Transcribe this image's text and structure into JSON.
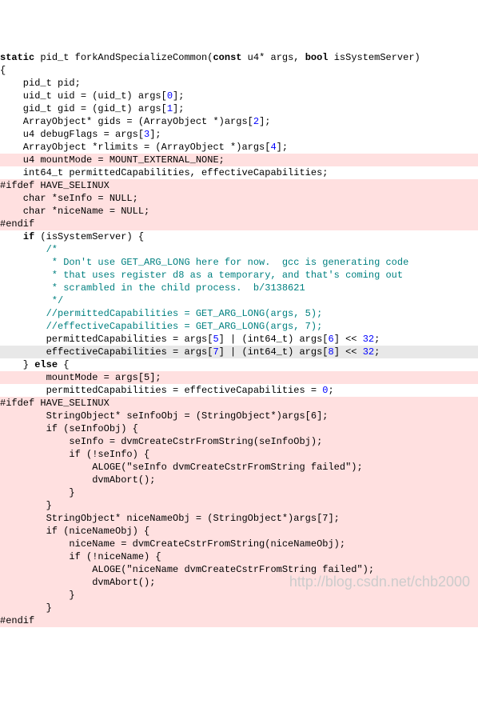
{
  "lines": [
    {
      "indent": 0,
      "parts": [
        {
          "t": "kw",
          "v": "static"
        },
        {
          "t": "",
          "v": " pid_t forkAndSpecializeCommon("
        },
        {
          "t": "kw",
          "v": "const"
        },
        {
          "t": "",
          "v": " u4* args, "
        },
        {
          "t": "kw",
          "v": "bool"
        },
        {
          "t": "",
          "v": " isSystemServer)"
        }
      ],
      "hl": false
    },
    {
      "indent": 0,
      "parts": [
        {
          "t": "",
          "v": "{"
        }
      ],
      "hl": false
    },
    {
      "indent": 4,
      "parts": [
        {
          "t": "",
          "v": "pid_t pid;"
        }
      ],
      "hl": false
    },
    {
      "indent": 0,
      "parts": [
        {
          "t": "",
          "v": ""
        }
      ],
      "hl": false
    },
    {
      "indent": 4,
      "parts": [
        {
          "t": "",
          "v": "uid_t uid = (uid_t) args["
        },
        {
          "t": "num",
          "v": "0"
        },
        {
          "t": "",
          "v": "];"
        }
      ],
      "hl": false
    },
    {
      "indent": 4,
      "parts": [
        {
          "t": "",
          "v": "gid_t gid = (gid_t) args["
        },
        {
          "t": "num",
          "v": "1"
        },
        {
          "t": "",
          "v": "];"
        }
      ],
      "hl": false
    },
    {
      "indent": 4,
      "parts": [
        {
          "t": "",
          "v": "ArrayObject* gids = (ArrayObject *)args["
        },
        {
          "t": "num",
          "v": "2"
        },
        {
          "t": "",
          "v": "];"
        }
      ],
      "hl": false
    },
    {
      "indent": 4,
      "parts": [
        {
          "t": "",
          "v": "u4 debugFlags = args["
        },
        {
          "t": "num",
          "v": "3"
        },
        {
          "t": "",
          "v": "];"
        }
      ],
      "hl": false
    },
    {
      "indent": 4,
      "parts": [
        {
          "t": "",
          "v": "ArrayObject *rlimits = (ArrayObject *)args["
        },
        {
          "t": "num",
          "v": "4"
        },
        {
          "t": "",
          "v": "];"
        }
      ],
      "hl": false
    },
    {
      "indent": 4,
      "parts": [
        {
          "t": "",
          "v": "u4 mountMode = MOUNT_EXTERNAL_NONE;"
        }
      ],
      "hl": true
    },
    {
      "indent": 4,
      "parts": [
        {
          "t": "",
          "v": "int64_t permittedCapabilities, effectiveCapabilities;"
        }
      ],
      "hl": false
    },
    {
      "indent": 0,
      "parts": [
        {
          "t": "",
          "v": "#ifdef HAVE_SELINUX"
        }
      ],
      "hl": true
    },
    {
      "indent": 4,
      "parts": [
        {
          "t": "",
          "v": "char *seInfo = NULL;"
        }
      ],
      "hl": true
    },
    {
      "indent": 4,
      "parts": [
        {
          "t": "",
          "v": "char *niceName = NULL;"
        }
      ],
      "hl": true
    },
    {
      "indent": 0,
      "parts": [
        {
          "t": "",
          "v": "#endif"
        }
      ],
      "hl": true
    },
    {
      "indent": 0,
      "parts": [
        {
          "t": "",
          "v": ""
        }
      ],
      "hl": false
    },
    {
      "indent": 4,
      "parts": [
        {
          "t": "kw",
          "v": "if"
        },
        {
          "t": "",
          "v": " (isSystemServer) {"
        }
      ],
      "hl": false
    },
    {
      "indent": 8,
      "parts": [
        {
          "t": "cmt",
          "v": "/*"
        }
      ],
      "hl": false
    },
    {
      "indent": 8,
      "parts": [
        {
          "t": "cmt",
          "v": " * Don't use GET_ARG_LONG here for now.  gcc is generating code"
        }
      ],
      "hl": false
    },
    {
      "indent": 8,
      "parts": [
        {
          "t": "cmt",
          "v": " * that uses register d8 as a temporary, and that's coming out"
        }
      ],
      "hl": false
    },
    {
      "indent": 8,
      "parts": [
        {
          "t": "cmt",
          "v": " * scrambled in the child process.  b/3138621"
        }
      ],
      "hl": false
    },
    {
      "indent": 8,
      "parts": [
        {
          "t": "cmt",
          "v": " */"
        }
      ],
      "hl": false
    },
    {
      "indent": 8,
      "parts": [
        {
          "t": "cmt",
          "v": "//permittedCapabilities = GET_ARG_LONG(args, 5);"
        }
      ],
      "hl": false
    },
    {
      "indent": 8,
      "parts": [
        {
          "t": "cmt",
          "v": "//effectiveCapabilities = GET_ARG_LONG(args, 7);"
        }
      ],
      "hl": false
    },
    {
      "indent": 8,
      "parts": [
        {
          "t": "",
          "v": "permittedCapabilities = args["
        },
        {
          "t": "num",
          "v": "5"
        },
        {
          "t": "",
          "v": "] | (int64_t) args["
        },
        {
          "t": "num",
          "v": "6"
        },
        {
          "t": "",
          "v": "] << "
        },
        {
          "t": "num",
          "v": "32"
        },
        {
          "t": "",
          "v": ";"
        }
      ],
      "hl": false
    },
    {
      "indent": 8,
      "parts": [
        {
          "t": "",
          "v": "effectiveCapabilities = args["
        },
        {
          "t": "num",
          "v": "7"
        },
        {
          "t": "",
          "v": "] | (int64_t) args["
        },
        {
          "t": "num",
          "v": "8"
        },
        {
          "t": "",
          "v": "] << "
        },
        {
          "t": "num",
          "v": "32"
        },
        {
          "t": "",
          "v": ";"
        }
      ],
      "hl": false,
      "cursor": true
    },
    {
      "indent": 4,
      "parts": [
        {
          "t": "",
          "v": "} "
        },
        {
          "t": "kw",
          "v": "else"
        },
        {
          "t": "",
          "v": " {"
        }
      ],
      "hl": false
    },
    {
      "indent": 8,
      "parts": [
        {
          "t": "",
          "v": "mountMode = args[5];"
        }
      ],
      "hl": true
    },
    {
      "indent": 8,
      "parts": [
        {
          "t": "",
          "v": "permittedCapabilities = effectiveCapabilities = "
        },
        {
          "t": "num",
          "v": "0"
        },
        {
          "t": "",
          "v": ";"
        }
      ],
      "hl": false
    },
    {
      "indent": 0,
      "parts": [
        {
          "t": "",
          "v": "#ifdef HAVE_SELINUX"
        }
      ],
      "hl": true
    },
    {
      "indent": 8,
      "parts": [
        {
          "t": "",
          "v": "StringObject* seInfoObj = (StringObject*)args[6];"
        }
      ],
      "hl": true
    },
    {
      "indent": 8,
      "parts": [
        {
          "t": "",
          "v": "if (seInfoObj) {"
        }
      ],
      "hl": true
    },
    {
      "indent": 12,
      "parts": [
        {
          "t": "",
          "v": "seInfo = dvmCreateCstrFromString(seInfoObj);"
        }
      ],
      "hl": true
    },
    {
      "indent": 12,
      "parts": [
        {
          "t": "",
          "v": "if (!seInfo) {"
        }
      ],
      "hl": true
    },
    {
      "indent": 16,
      "parts": [
        {
          "t": "",
          "v": "ALOGE(\"seInfo dvmCreateCstrFromString failed\");"
        }
      ],
      "hl": true
    },
    {
      "indent": 16,
      "parts": [
        {
          "t": "",
          "v": "dvmAbort();"
        }
      ],
      "hl": true
    },
    {
      "indent": 12,
      "parts": [
        {
          "t": "",
          "v": "}"
        }
      ],
      "hl": true
    },
    {
      "indent": 8,
      "parts": [
        {
          "t": "",
          "v": "}"
        }
      ],
      "hl": true
    },
    {
      "indent": 8,
      "parts": [
        {
          "t": "",
          "v": "StringObject* niceNameObj = (StringObject*)args[7];"
        }
      ],
      "hl": true
    },
    {
      "indent": 8,
      "parts": [
        {
          "t": "",
          "v": "if (niceNameObj) {"
        }
      ],
      "hl": true
    },
    {
      "indent": 12,
      "parts": [
        {
          "t": "",
          "v": "niceName = dvmCreateCstrFromString(niceNameObj);"
        }
      ],
      "hl": true
    },
    {
      "indent": 12,
      "parts": [
        {
          "t": "",
          "v": "if (!niceName) {"
        }
      ],
      "hl": true
    },
    {
      "indent": 16,
      "parts": [
        {
          "t": "",
          "v": "ALOGE(\"niceName dvmCreateCstrFromString failed\");"
        }
      ],
      "hl": true
    },
    {
      "indent": 16,
      "parts": [
        {
          "t": "",
          "v": "dvmAbort();"
        }
      ],
      "hl": true
    },
    {
      "indent": 12,
      "parts": [
        {
          "t": "",
          "v": "}"
        }
      ],
      "hl": true
    },
    {
      "indent": 8,
      "parts": [
        {
          "t": "",
          "v": "}"
        }
      ],
      "hl": true
    },
    {
      "indent": 0,
      "parts": [
        {
          "t": "",
          "v": "#endif"
        }
      ],
      "hl": true
    }
  ],
  "watermark": "http://blog.csdn.net/chb2000"
}
